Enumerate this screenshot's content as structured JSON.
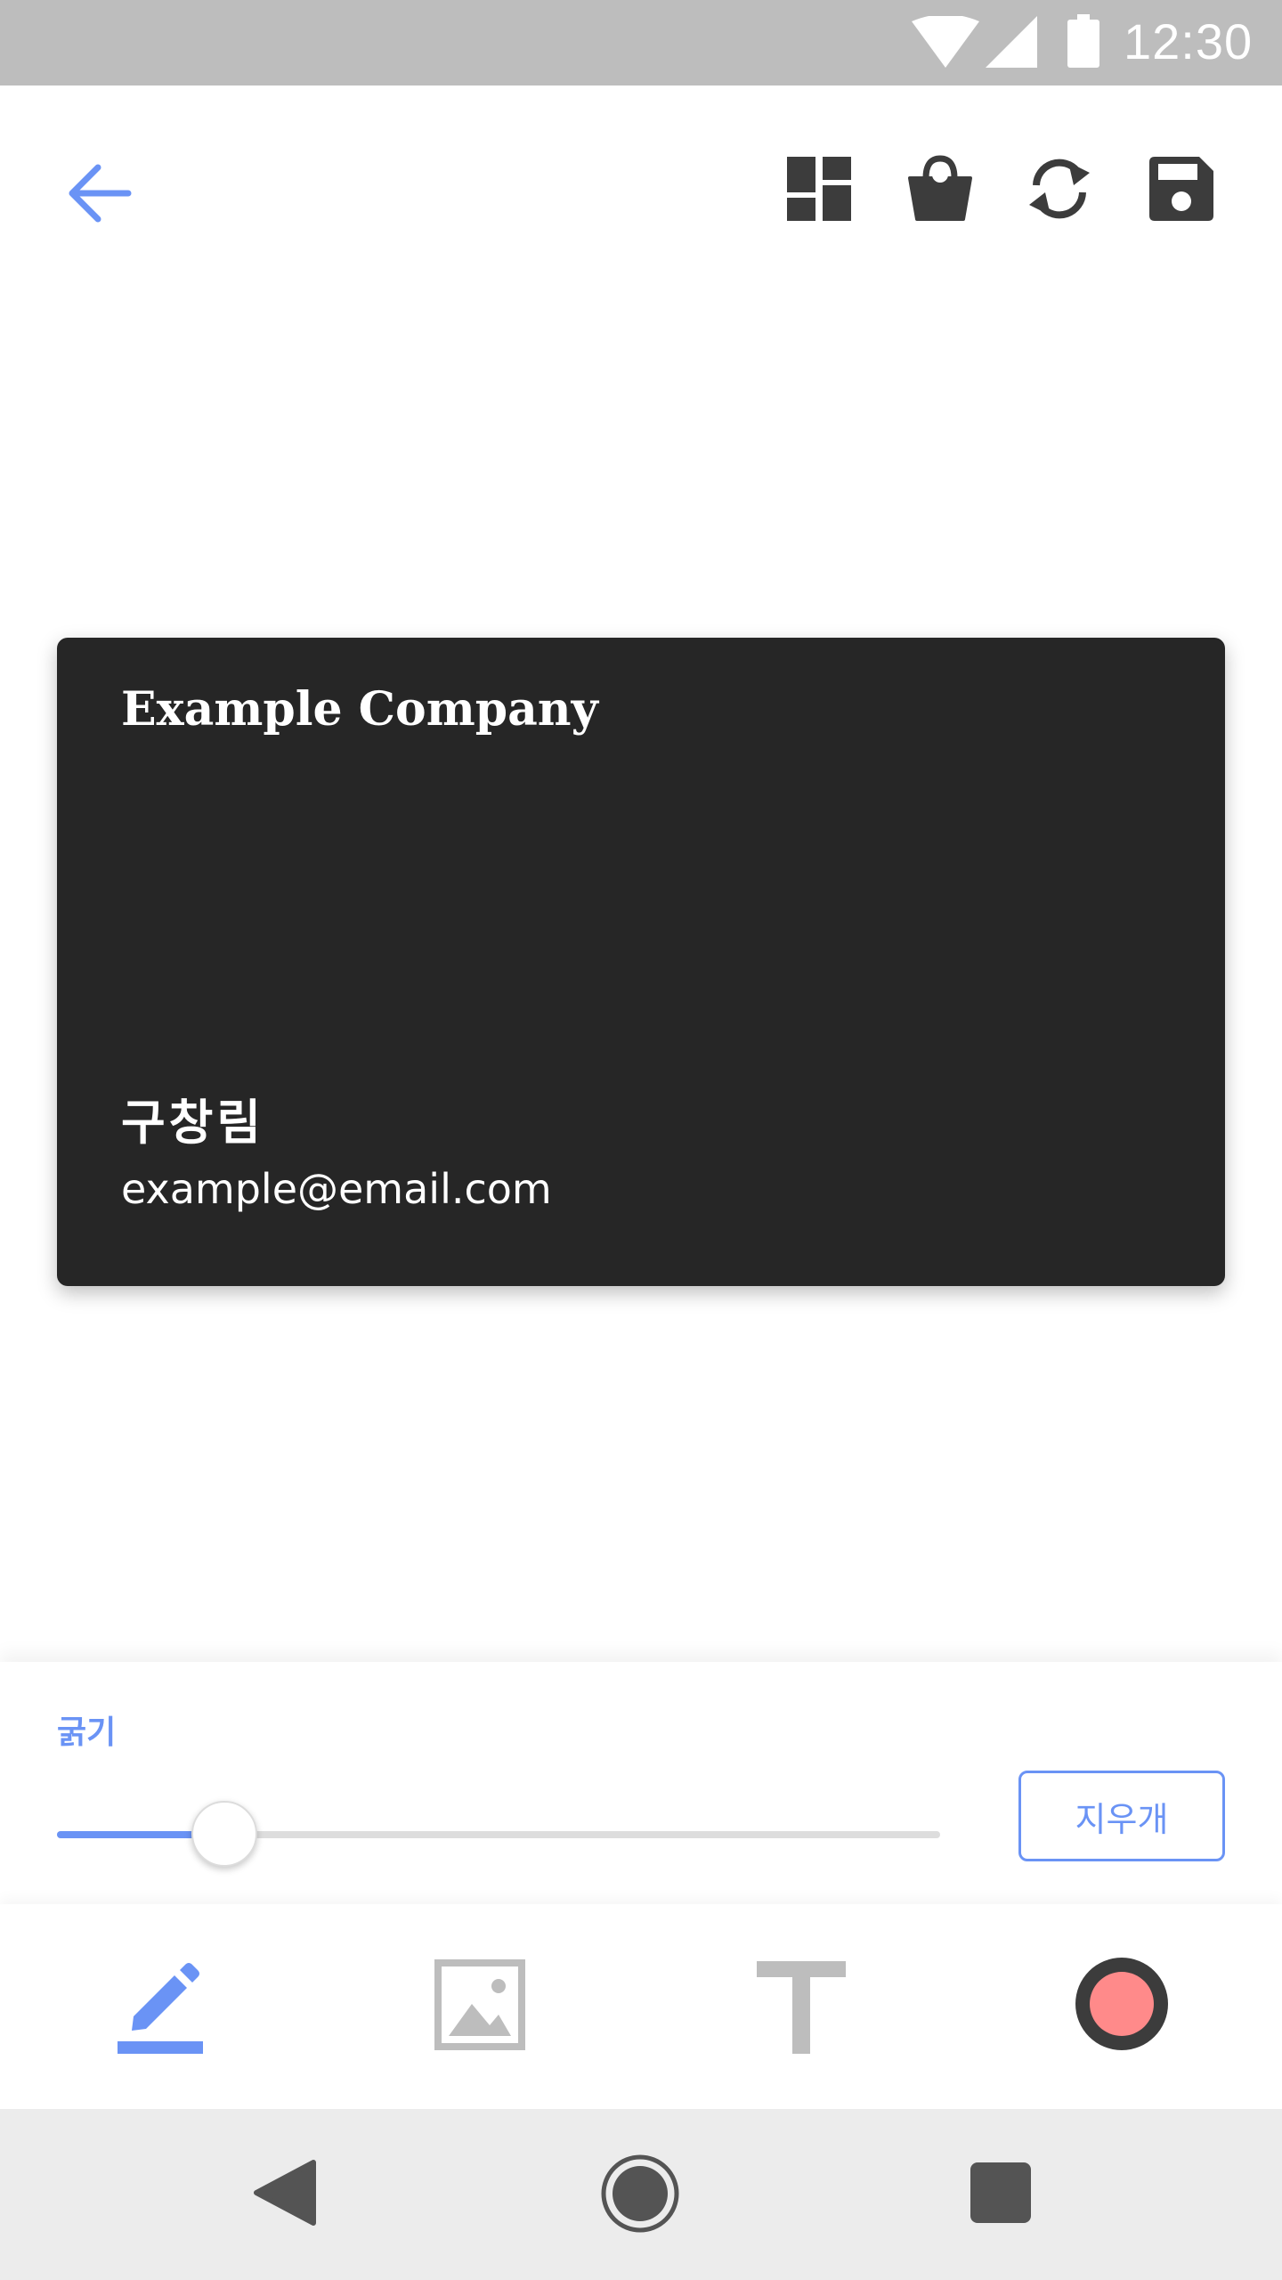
{
  "status_bar": {
    "time": "12:30"
  },
  "toolbar": {
    "icons": [
      "back-arrow-icon",
      "dashboard-layout-icon",
      "shopping-bag-icon",
      "sync-icon",
      "save-floppy-icon"
    ]
  },
  "card": {
    "company": "Example Company",
    "name": "구창림",
    "email": "example@email.com"
  },
  "thickness_panel": {
    "label": "굵기",
    "slider_value_fraction": 0.19,
    "eraser_label": "지우개"
  },
  "tools": {
    "items": [
      "pen-tool",
      "image-tool",
      "text-tool",
      "color-tool"
    ],
    "selected": "pen-tool"
  },
  "colors": {
    "accent": "#6a93f5",
    "card_background": "#262626",
    "selected_pen_color": "#ff8a8a",
    "inactive_tool": "#bdbdbd",
    "icon_dark": "#3c3c3c"
  }
}
